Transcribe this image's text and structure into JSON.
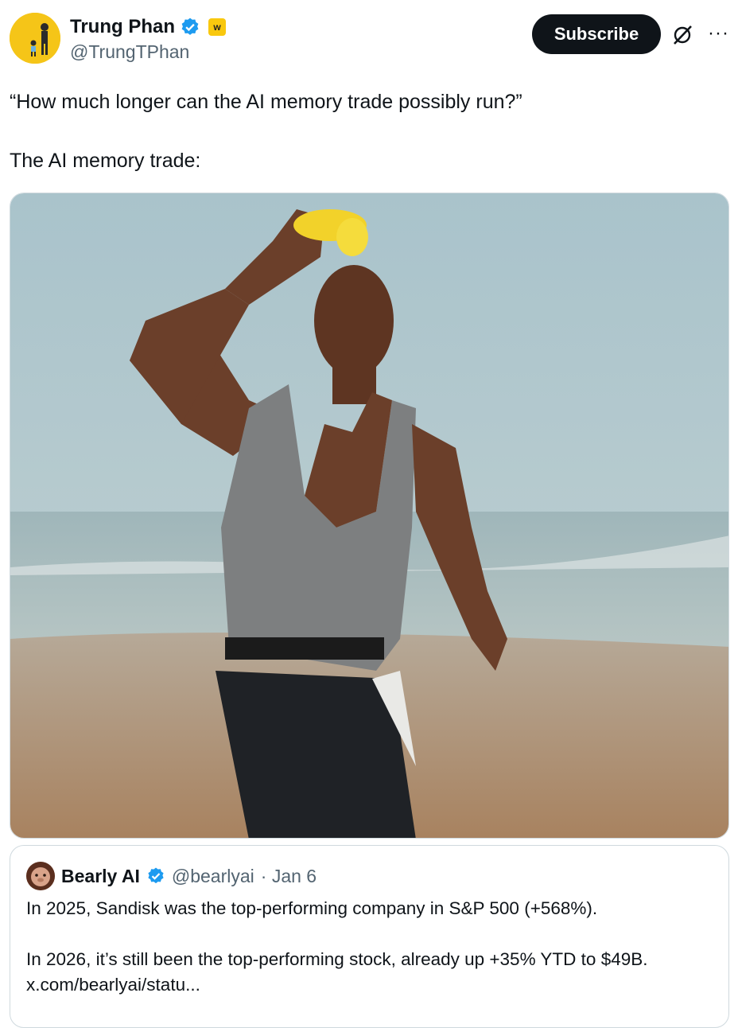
{
  "author": {
    "name": "Trung Phan",
    "handle": "@TrungTPhan",
    "avatar_color": "#f5c518",
    "verified_icon": "verified-badge-icon",
    "affiliate_icon": "w-badge-icon"
  },
  "actions": {
    "subscribe_label": "Subscribe",
    "grok_icon": "grok-icon",
    "more_label": "···"
  },
  "tweet": {
    "line1": "“How much longer can the AI memory trade possibly run?”",
    "line2": "The AI memory trade:"
  },
  "media": {
    "description_icon": "photo-runner-beach"
  },
  "quoted": {
    "name": "Bearly AI",
    "handle": "@bearlyai",
    "date": "· Jan 6",
    "line1": "In 2025, Sandisk was the top-performing company in S&P 500 (+568%).",
    "line2": "In 2026, it’s still been the top-performing stock, already up +35% YTD to $49B.",
    "link": "x.com/bearlyai/statu..."
  },
  "colors": {
    "accent": "#1d9bf0",
    "text": "#0f1419",
    "muted": "#536471",
    "button": "#0f1419"
  }
}
